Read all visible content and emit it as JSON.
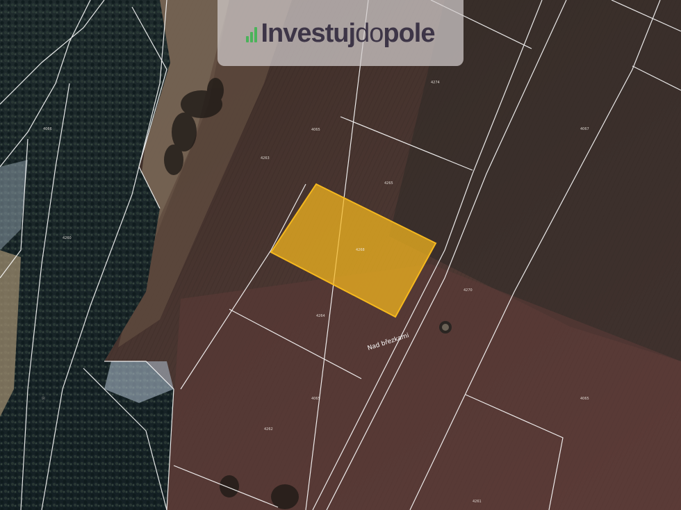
{
  "brand": {
    "name_part1": "Investuj",
    "name_part2": "do",
    "name_part3": "pole",
    "icon": "bar-chart-icon",
    "accent_color": "#4bb35a",
    "text_color": "#3d3547"
  },
  "map": {
    "place_label": "Nad březkami",
    "highlight_color": "#f6b91e",
    "parcel_line_color": "#ffffff",
    "parcel_numbers": [
      "4066",
      "4065",
      "4263",
      "4265",
      "4268",
      "4270",
      "4274",
      "4264",
      "4260",
      "4067",
      "4065",
      "4065",
      "4262",
      "4261"
    ]
  }
}
